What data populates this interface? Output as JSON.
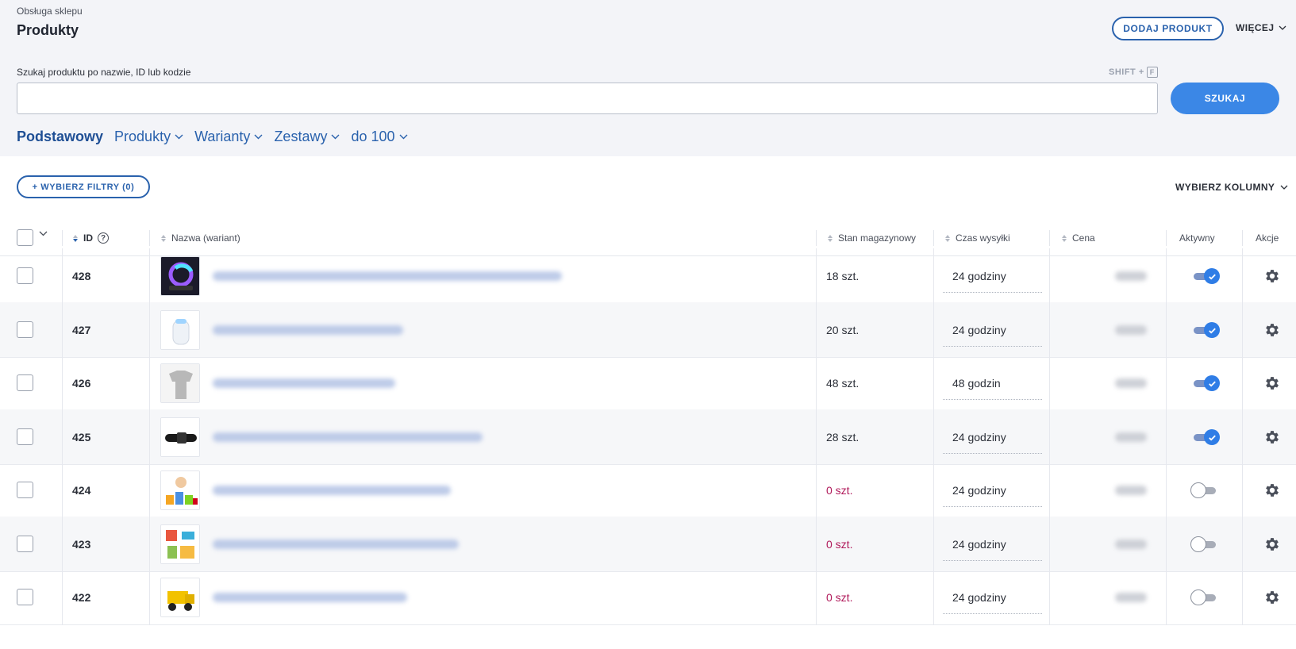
{
  "header": {
    "breadcrumb": "Obsługa sklepu",
    "title": "Produkty",
    "add_button": "DODAJ PRODUKT",
    "more_menu": "WIĘCEJ"
  },
  "search": {
    "label": "Szukaj produktu po nazwie, ID lub kodzie",
    "shortcut_prefix": "SHIFT +",
    "shortcut_key": "F",
    "value": "",
    "placeholder": "",
    "button": "SZUKAJ"
  },
  "tabs": [
    {
      "label": "Podstawowy",
      "active": true
    },
    {
      "label": "Produkty",
      "active": false
    },
    {
      "label": "Warianty",
      "active": false
    },
    {
      "label": "Zestawy",
      "active": false
    },
    {
      "label": "do 100",
      "active": false
    }
  ],
  "toolbar": {
    "filter_button": "+ WYBIERZ FILTRY (0)",
    "columns_button": "WYBIERZ KOLUMNY"
  },
  "table": {
    "columns": {
      "id": "ID",
      "name": "Nazwa (wariant)",
      "stock": "Stan magazynowy",
      "shipping": "Czas wysyłki",
      "price": "Cena",
      "active": "Aktywny",
      "actions": "Akcje"
    },
    "rows": [
      {
        "id": "428",
        "stock": "18 szt.",
        "shipping": "24 godziny",
        "active": true,
        "zero": false,
        "thumb": "lamp-icon",
        "name_width": 440
      },
      {
        "id": "427",
        "stock": "20 szt.",
        "shipping": "24 godziny",
        "active": true,
        "zero": false,
        "thumb": "humidifier-icon",
        "name_width": 240
      },
      {
        "id": "426",
        "stock": "48 szt.",
        "shipping": "48 godzin",
        "active": true,
        "zero": false,
        "thumb": "clothing-icon",
        "name_width": 230
      },
      {
        "id": "425",
        "stock": "28 szt.",
        "shipping": "24 godziny",
        "active": true,
        "zero": false,
        "thumb": "collar-icon",
        "name_width": 340
      },
      {
        "id": "424",
        "stock": "0 szt.",
        "shipping": "24 godziny",
        "active": false,
        "zero": true,
        "thumb": "blocks-icon",
        "name_width": 300
      },
      {
        "id": "423",
        "stock": "0 szt.",
        "shipping": "24 godziny",
        "active": false,
        "zero": true,
        "thumb": "blocks-set-icon",
        "name_width": 310
      },
      {
        "id": "422",
        "stock": "0 szt.",
        "shipping": "24 godziny",
        "active": false,
        "zero": true,
        "thumb": "toy-truck-icon",
        "name_width": 245
      }
    ]
  },
  "colors": {
    "accent": "#2a62ad",
    "primary_button": "#3b87e6",
    "zero_stock": "#b0195a",
    "toggle_on": "#2f7de6"
  }
}
